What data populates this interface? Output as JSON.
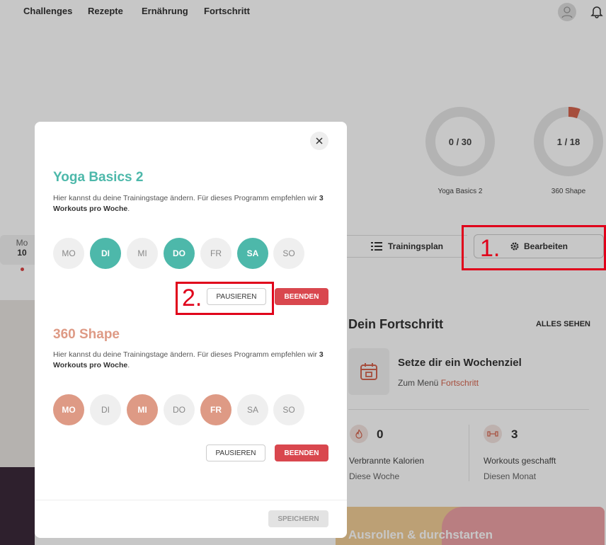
{
  "nav": {
    "items": [
      "Challenges",
      "Rezepte",
      "Ernährung",
      "Fortschritt"
    ]
  },
  "rings": [
    {
      "value": "0 / 30",
      "label": "Yoga Basics 2",
      "progress": 0
    },
    {
      "value": "1 / 18",
      "label": "360 Shape",
      "progress": 0.0556
    }
  ],
  "day_strip": {
    "weekday": "Mo",
    "date": "10"
  },
  "buttons": {
    "plan": "Trainingsplan",
    "edit": "Bearbeiten"
  },
  "annotations": {
    "one": "1.",
    "two": "2."
  },
  "progress_card": {
    "title": "Dein Fortschritt",
    "see_all": "ALLES SEHEN",
    "goal_title": "Setze dir ein Wochenziel",
    "goal_sub_prefix": "Zum Menü ",
    "goal_sub_link": "Fortschritt",
    "calories_num": "0",
    "calories_label": "Verbrannte Kalorien",
    "calories_sub": "Diese Woche",
    "workouts_num": "3",
    "workouts_label": "Workouts geschafft",
    "workouts_sub": "Diesen Monat"
  },
  "banner": {
    "text": "Ausrollen & durchstarten"
  },
  "modal": {
    "programs": [
      {
        "title": "Yoga Basics 2",
        "color": "#4db8aa",
        "desc_prefix": "Hier kannst du deine Trainingstage ändern. Für dieses Programm empfehlen wir ",
        "desc_bold": "3 Workouts pro Woche",
        "desc_suffix": ".",
        "days": [
          {
            "label": "MO",
            "active": false
          },
          {
            "label": "DI",
            "active": true
          },
          {
            "label": "MI",
            "active": false
          },
          {
            "label": "DO",
            "active": true
          },
          {
            "label": "FR",
            "active": false
          },
          {
            "label": "SA",
            "active": true
          },
          {
            "label": "SO",
            "active": false
          }
        ],
        "pause": "PAUSIEREN",
        "end": "BEENDEN"
      },
      {
        "title": "360 Shape",
        "color": "#de9a85",
        "desc_prefix": "Hier kannst du deine Trainingstage ändern. Für dieses Programm empfehlen wir ",
        "desc_bold": "3 Workouts pro Woche",
        "desc_suffix": ".",
        "days": [
          {
            "label": "MO",
            "active": true
          },
          {
            "label": "DI",
            "active": false
          },
          {
            "label": "MI",
            "active": true
          },
          {
            "label": "DO",
            "active": false
          },
          {
            "label": "FR",
            "active": true
          },
          {
            "label": "SA",
            "active": false
          },
          {
            "label": "SO",
            "active": false
          }
        ],
        "pause": "PAUSIEREN",
        "end": "BEENDEN"
      }
    ],
    "save": "SPEICHERN"
  },
  "colors": {
    "teal": "#4db8aa",
    "salmon": "#de9a85",
    "red": "#d9474e",
    "highlight": "#e0001a"
  }
}
